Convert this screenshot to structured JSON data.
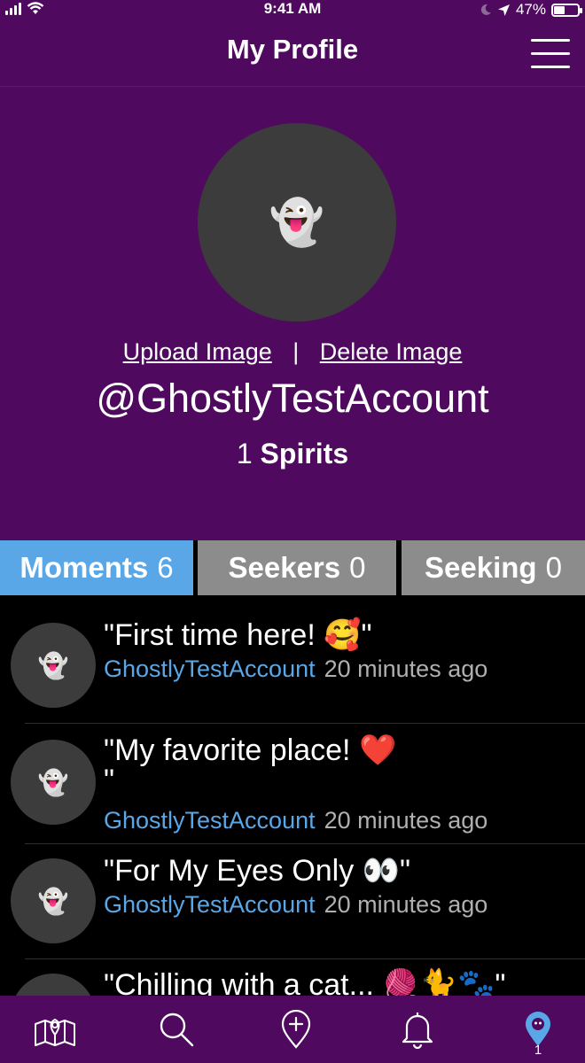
{
  "status_bar": {
    "time": "9:41 AM",
    "battery_text": "47%",
    "battery_level": 0.47,
    "icons": [
      "signal-icon",
      "wifi-icon",
      "moon-icon",
      "location-arrow-icon",
      "battery-icon"
    ]
  },
  "nav": {
    "title": "My Profile",
    "menu_icon": "hamburger-menu-icon"
  },
  "profile": {
    "avatar_emoji": "👻",
    "upload_label": "Upload Image",
    "separator": "|",
    "delete_label": "Delete Image",
    "username": "@GhostlyTestAccount",
    "spirits_count": "1",
    "spirits_label": "Spirits"
  },
  "tabs": [
    {
      "label": "Moments",
      "count": "6",
      "active": true
    },
    {
      "label": "Seekers",
      "count": "0",
      "active": false
    },
    {
      "label": "Seeking",
      "count": "0",
      "active": false
    }
  ],
  "moments": [
    {
      "avatar_emoji": "👻",
      "text": "\"First time here! 🥰\"",
      "author": "GhostlyTestAccount",
      "time": "20 minutes ago"
    },
    {
      "avatar_emoji": "👻",
      "text": "\"My favorite place! ❤️\n\"",
      "author": "GhostlyTestAccount",
      "time": "20 minutes ago"
    },
    {
      "avatar_emoji": "👻",
      "text": "\"For My Eyes Only 👀\"",
      "author": "GhostlyTestAccount",
      "time": "20 minutes ago"
    },
    {
      "avatar_emoji": "👻",
      "text": "\"Chilling with a cat... 🧶🐈🐾\"",
      "author": "",
      "time": ""
    }
  ],
  "tab_bar": {
    "items": [
      "map-icon",
      "search-icon",
      "add-location-icon",
      "bell-icon",
      "profile-pin-icon"
    ],
    "active": "profile-pin-icon",
    "profile_badge": "1"
  },
  "colors": {
    "header_bg": "#4f0a5f",
    "active_tab": "#5aa7e8",
    "inactive_tab": "#8c8c8c",
    "author_link": "#5aa7e8",
    "avatar_bg": "#3c3c3c"
  }
}
